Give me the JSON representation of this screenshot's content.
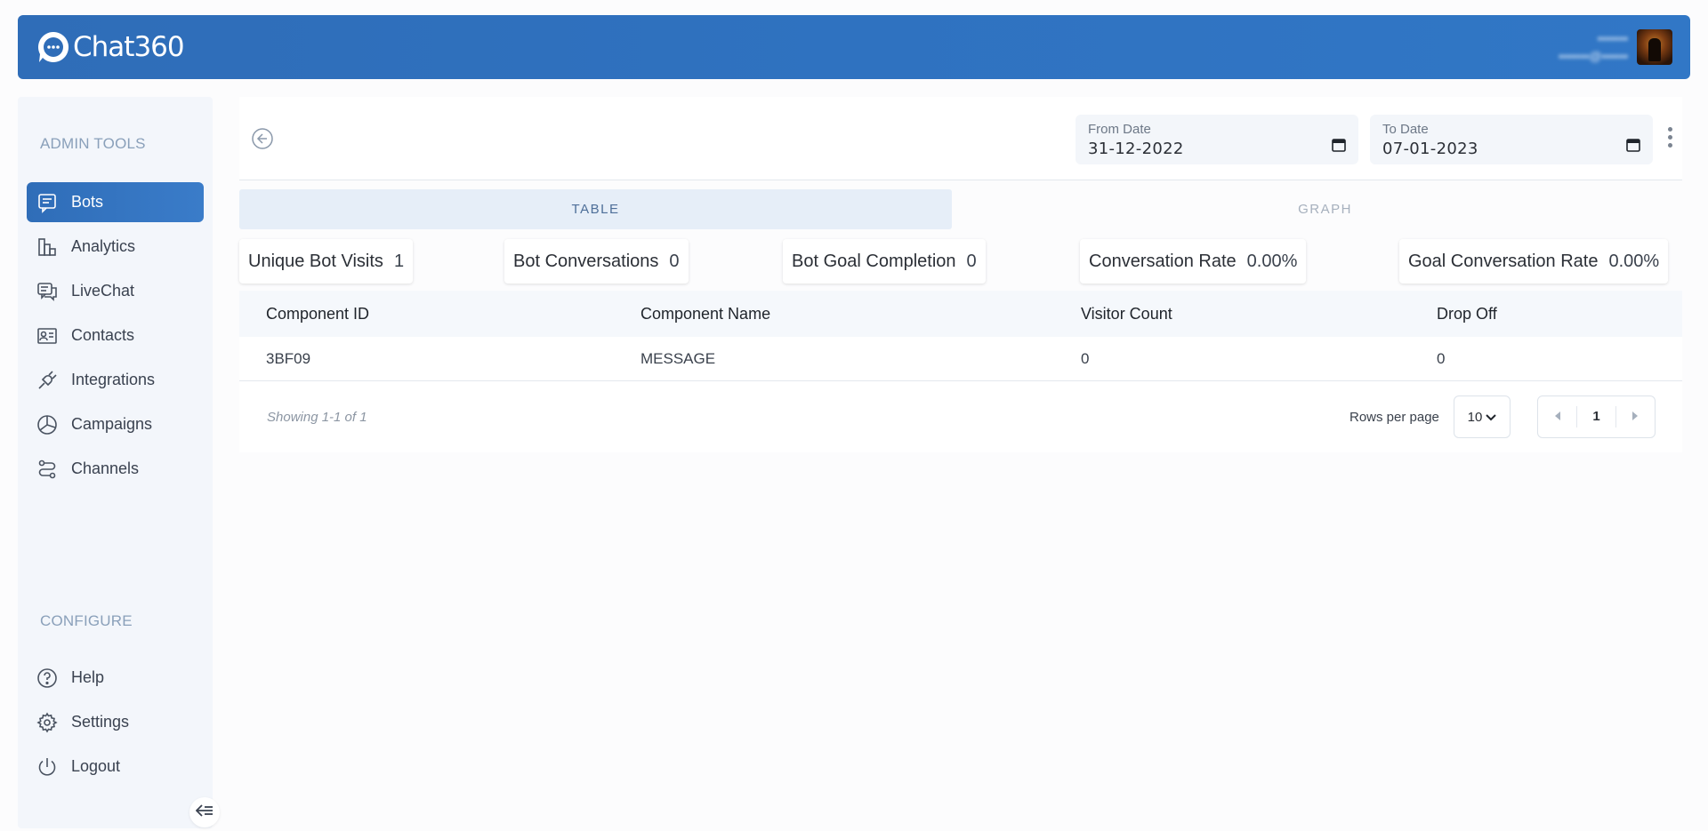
{
  "header": {
    "brand": "Chat360",
    "user_name": "•••••••",
    "user_email": "•••••••@••••••"
  },
  "sidebar": {
    "admin_title": "ADMIN TOOLS",
    "configure_title": "CONFIGURE",
    "items": [
      {
        "label": "Bots",
        "icon": "bots-icon"
      },
      {
        "label": "Analytics",
        "icon": "analytics-icon"
      },
      {
        "label": "LiveChat",
        "icon": "livechat-icon"
      },
      {
        "label": "Contacts",
        "icon": "contacts-icon"
      },
      {
        "label": "Integrations",
        "icon": "plug-icon"
      },
      {
        "label": "Campaigns",
        "icon": "pie-icon"
      },
      {
        "label": "Channels",
        "icon": "channels-icon"
      }
    ],
    "config_items": [
      {
        "label": "Help",
        "icon": "help-icon"
      },
      {
        "label": "Settings",
        "icon": "gear-icon"
      },
      {
        "label": "Logout",
        "icon": "power-icon"
      }
    ]
  },
  "filters": {
    "from_label": "From Date",
    "from_value": "31-12-2022",
    "to_label": "To Date",
    "to_value": "07-01-2023"
  },
  "tabs": {
    "table": "TABLE",
    "graph": "GRAPH",
    "active": "TABLE"
  },
  "metrics": [
    {
      "label": "Unique Bot Visits",
      "value": "1"
    },
    {
      "label": "Bot Conversations",
      "value": "0"
    },
    {
      "label": "Bot Goal Completion",
      "value": "0"
    },
    {
      "label": "Conversation Rate",
      "value": "0.00%"
    },
    {
      "label": "Goal Conversation Rate",
      "value": "0.00%"
    }
  ],
  "table": {
    "columns": [
      "Component ID",
      "Component Name",
      "Visitor Count",
      "Drop Off"
    ],
    "rows": [
      [
        "3BF09",
        "MESSAGE",
        "0",
        "0"
      ]
    ]
  },
  "pagination": {
    "showing": "Showing 1-1 of 1",
    "rows_per_page_label": "Rows per page",
    "rows_per_page": "10",
    "current_page": "1"
  },
  "colors": {
    "primary": "#2f6db8",
    "sidebar_bg": "#f3f6fb",
    "tab_active_bg": "#e6eef8"
  }
}
